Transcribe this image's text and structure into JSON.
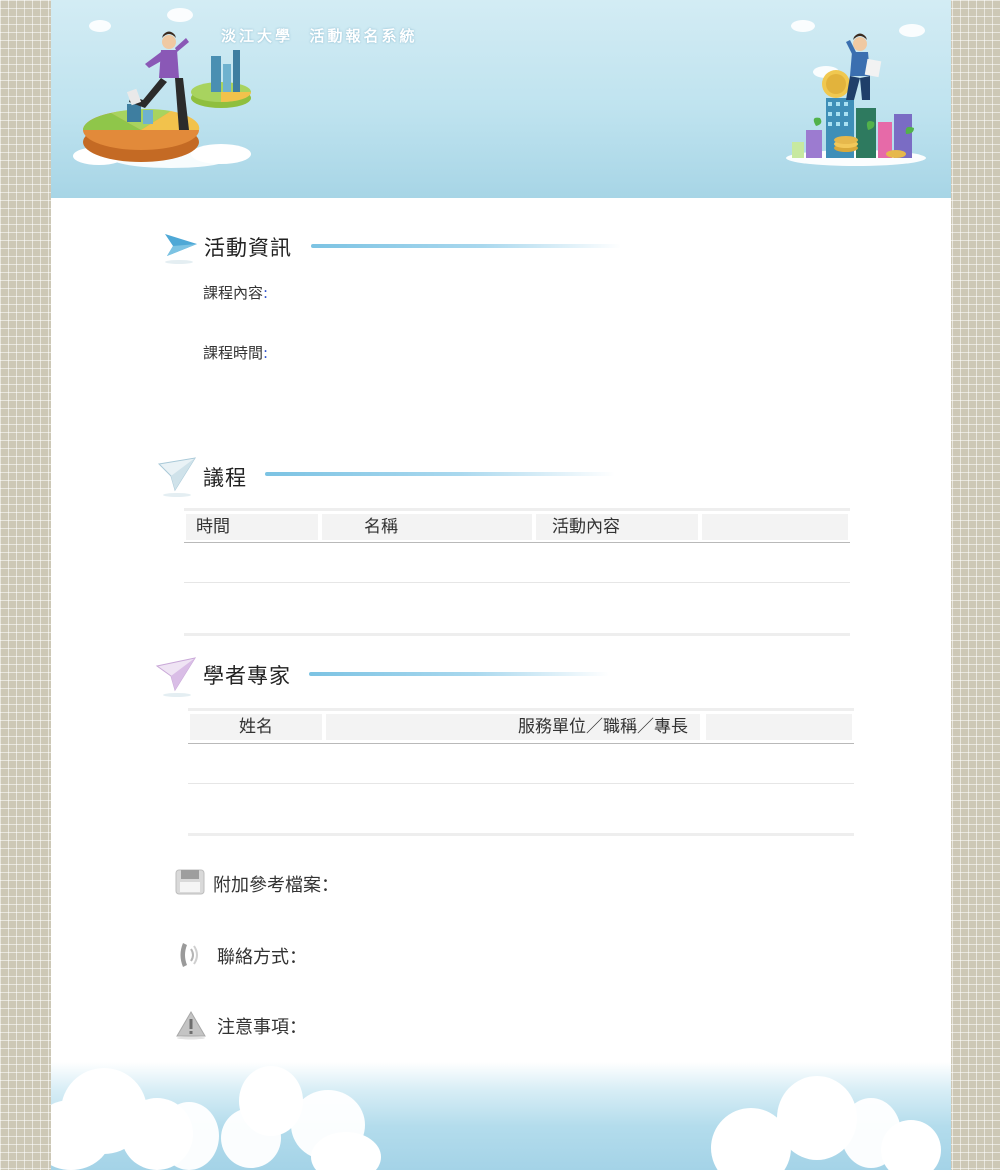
{
  "header": {
    "title": "淡江大學  活動報名系統"
  },
  "activity_info": {
    "title": "活動資訊",
    "course_content_label": "課程內容",
    "course_time_label": "課程時間",
    "colon": ":"
  },
  "agenda": {
    "title": "議程",
    "columns": [
      "時間",
      "名稱",
      "活動內容",
      ""
    ]
  },
  "experts": {
    "title": "學者專家",
    "columns": [
      "姓名",
      "服務單位／職稱／專長",
      ""
    ]
  },
  "attachments": {
    "label": "附加參考檔案："
  },
  "contact": {
    "label": "聯絡方式："
  },
  "notes": {
    "label": "注意事項："
  },
  "colors": {
    "banner_sky": "#bfe3ef",
    "section_line": "#7cc3e3",
    "table_header_bg": "#f3f3f3",
    "page_bg": "#cdc8b6"
  },
  "icons": [
    "paper-plane-blue-icon",
    "paper-plane-white-icon",
    "paper-plane-purple-icon",
    "floppy-disk-icon",
    "phone-icon",
    "warning-icon"
  ]
}
